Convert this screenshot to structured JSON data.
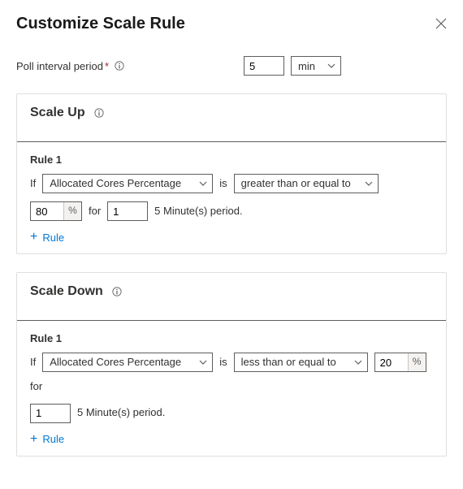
{
  "title": "Customize Scale Rule",
  "poll": {
    "label": "Poll interval period",
    "required_marker": "*",
    "value": "5",
    "unit": "min"
  },
  "sections": {
    "up": {
      "title": "Scale Up",
      "rule_label": "Rule 1",
      "if": "If",
      "metric": "Allocated Cores Percentage",
      "is": "is",
      "operator": "greater than or equal to",
      "threshold": "80",
      "pct": "%",
      "for": "for",
      "periods": "1",
      "period_text": "5 Minute(s) period.",
      "add": "Rule"
    },
    "down": {
      "title": "Scale Down",
      "rule_label": "Rule 1",
      "if": "If",
      "metric": "Allocated Cores Percentage",
      "is": "is",
      "operator": "less than or equal to",
      "threshold": "20",
      "pct": "%",
      "for": "for",
      "periods": "1",
      "period_text": "5 Minute(s) period.",
      "add": "Rule"
    }
  }
}
